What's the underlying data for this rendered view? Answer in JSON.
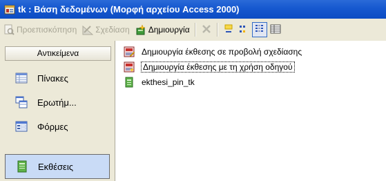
{
  "window": {
    "title": "tk : Βάση δεδομένων (Μορφή αρχείου Access 2000)"
  },
  "toolbar": {
    "preview_label": "Προεπισκόπηση",
    "design_label": "Σχεδίαση",
    "create_label": "Δημιουργία"
  },
  "sidebar": {
    "header": "Αντικείμενα",
    "items": [
      {
        "label": "Πίνακες",
        "icon": "table-icon"
      },
      {
        "label": "Ερωτήμ...",
        "icon": "query-icon"
      },
      {
        "label": "Φόρμες",
        "icon": "form-icon"
      },
      {
        "label": "Εκθέσεις",
        "icon": "report-icon",
        "selected": true
      }
    ]
  },
  "list": {
    "items": [
      {
        "label": "Δημιουργία έκθεσης σε προβολή σχεδίασης",
        "icon": "design-wizard-icon"
      },
      {
        "label": "Δημιουργία έκθεσης με τη χρήση οδηγού",
        "icon": "wizard-icon",
        "focused": true
      },
      {
        "label": "ekthesi_pin_tk",
        "icon": "report-icon"
      }
    ]
  }
}
